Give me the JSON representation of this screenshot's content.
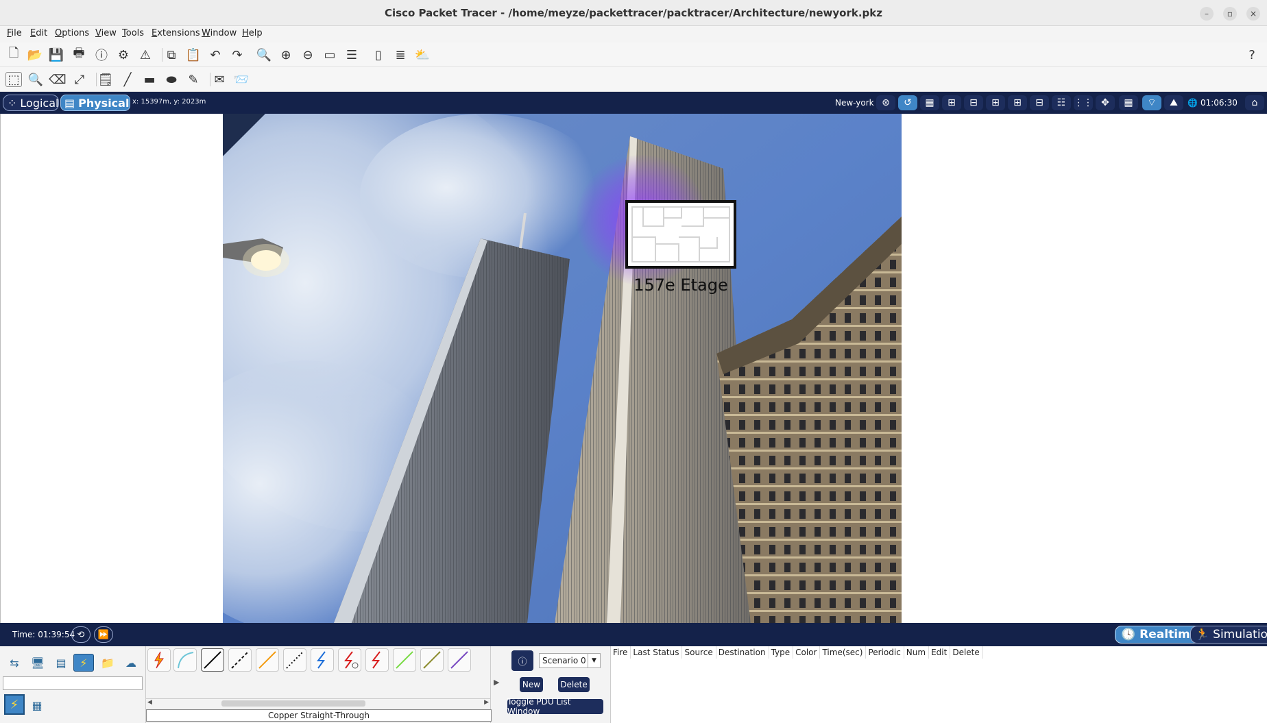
{
  "window": {
    "title": "Cisco Packet Tracer - /home/meyze/packettracer/packtracer/Architecture/newyork.pkz",
    "controls": [
      "–",
      "▫",
      "×"
    ]
  },
  "menu": [
    "File",
    "Edit",
    "Options",
    "View",
    "Tools",
    "Extensions",
    "Window",
    "Help"
  ],
  "toolbar1": {
    "icons": [
      "new-file-icon",
      "open-folder-icon",
      "save-icon",
      "print-icon",
      "info-icon",
      "network-wizard-icon",
      "activity-wizard-icon",
      "copy-icon",
      "paste-icon",
      "undo-icon",
      "redo-icon",
      "zoom-in-icon",
      "zoom-reset-icon",
      "zoom-out-icon",
      "drawing-palette-icon",
      "custom-device-icon",
      "viewport-icon",
      "cluster-icon",
      "cloud-icon"
    ],
    "help_label": "?"
  },
  "toolbar2": {
    "icons": [
      "select-icon",
      "inspect-icon",
      "delete-icon",
      "resize-icon",
      "note-icon",
      "line-icon",
      "rectangle-icon",
      "ellipse-icon",
      "freeform-icon",
      "simple-pdu-icon",
      "complex-pdu-icon"
    ]
  },
  "navbar": {
    "logical_label": "Logical",
    "physical_label": "Physical",
    "coords": "x: 15397m, y: 2023m",
    "location": "New-york",
    "clock": "01:06:30"
  },
  "workspace": {
    "floor_label": "157e Etage"
  },
  "statusbar": {
    "time_label": "Time: 01:39:54",
    "realtime_label": "Realtime",
    "simulation_label": "Simulation"
  },
  "bottom": {
    "selected_cable": "Copper Straight-Through",
    "scenario": "Scenario 0",
    "new_label": "New",
    "delete_label": "Delete",
    "toggle_label": "Toggle PDU List Window",
    "pdu_columns": [
      "Fire",
      "Last Status",
      "Source",
      "Destination",
      "Type",
      "Color",
      "Time(sec)",
      "Periodic",
      "Num",
      "Edit",
      "Delete"
    ]
  },
  "colors": {
    "navy": "#14224a",
    "accent_blue": "#3f86c6",
    "floor_glow": "#9040ff"
  }
}
